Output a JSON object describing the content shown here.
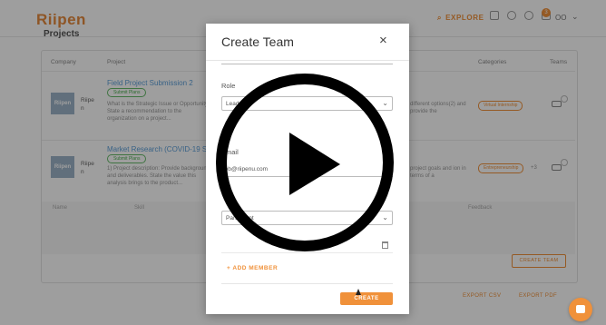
{
  "app": {
    "logo": "Riipen",
    "nav_explore": "EXPLORE",
    "notification_count": "3",
    "user_initials": "OO"
  },
  "page": {
    "section_title": "Projects",
    "table_headers": [
      "Company",
      "Project",
      "Categories",
      "Teams"
    ],
    "rows": [
      {
        "thumb": "Riipen",
        "company": "Riipe n",
        "title": "Field Project Submission 2",
        "tag": "Submit Plans",
        "desc": "What is the Strategic Issue or Opportunity? State a recommendation to the organization on a project...",
        "right_desc": "different options(2) and provide the",
        "category": "Virtual Internship",
        "plus": ""
      },
      {
        "thumb": "Riipen",
        "company": "Riipe n",
        "title": "Market Research (COVID-19 Specific)",
        "tag": "Submit Plans",
        "desc": "1) Project description: Provide background and deliverables. State the value this analysis brings to the product...",
        "right_desc": "project goals and ion in terms of a",
        "category": "Entrepreneurship",
        "plus": "+3"
      }
    ],
    "sub_headers": [
      "Name",
      "Skill",
      "Feedback"
    ],
    "create_team_label": "CREATE TEAM",
    "export_csv": "EXPORT CSV",
    "export_pdf": "EXPORT PDF"
  },
  "modal": {
    "title": "Create Team",
    "role_label": "Role",
    "role_value": "Leader",
    "email_label": "Email",
    "email_value": "bob@riipenu.com",
    "second_role_value": "Participant",
    "add_member": "ADD MEMBER",
    "create_button": "CREATE"
  },
  "icons": {
    "close": "close-icon",
    "play": "play-icon",
    "chat": "chat-icon"
  },
  "colors": {
    "accent": "#f0913a",
    "link": "#5c9fd8",
    "tag_green": "#4caf50"
  }
}
